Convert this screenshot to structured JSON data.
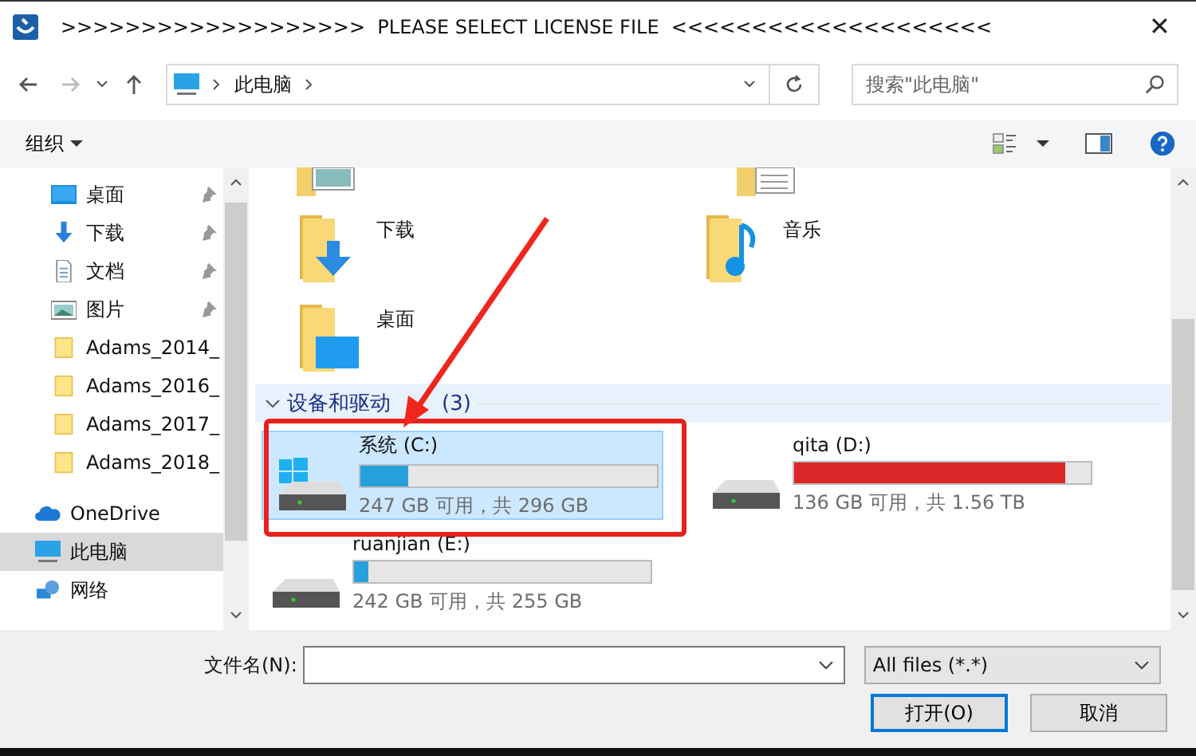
{
  "window": {
    "title": ">>>>>>>>>>>>>>>>>>>  PLEASE SELECT LICENSE FILE  <<<<<<<<<<<<<<<<<<<<",
    "close": "✕"
  },
  "nav": {
    "path": [
      "此电脑"
    ],
    "search": {
      "placeholder": "搜索\"此电脑\""
    }
  },
  "toolbar": {
    "organize": "组织"
  },
  "sidebar": {
    "items": [
      {
        "label": "桌面",
        "kind": "desktop",
        "pinned": true,
        "selected": false
      },
      {
        "label": "下载",
        "kind": "download",
        "pinned": true,
        "selected": false
      },
      {
        "label": "文档",
        "kind": "document",
        "pinned": true,
        "selected": false
      },
      {
        "label": "图片",
        "kind": "picture",
        "pinned": true,
        "selected": false
      },
      {
        "label": "Adams_2014_",
        "kind": "folder",
        "pinned": false,
        "selected": false
      },
      {
        "label": "Adams_2016_",
        "kind": "folder",
        "pinned": false,
        "selected": false
      },
      {
        "label": "Adams_2017_",
        "kind": "folder",
        "pinned": false,
        "selected": false
      },
      {
        "label": "Adams_2018_",
        "kind": "folder",
        "pinned": false,
        "selected": false
      },
      {
        "label": "OneDrive",
        "kind": "cloud",
        "pinned": false,
        "selected": false
      },
      {
        "label": "此电脑",
        "kind": "pc",
        "pinned": false,
        "selected": true
      },
      {
        "label": "网络",
        "kind": "network",
        "pinned": false,
        "selected": false
      }
    ]
  },
  "folders": [
    {
      "label": "下载",
      "kind": "download"
    },
    {
      "label": "音乐",
      "kind": "music"
    },
    {
      "label": "桌面",
      "kind": "desktop"
    }
  ],
  "section": {
    "title": "设备和驱动",
    "count": "(3)",
    "expanded": true
  },
  "drives": [
    {
      "name": "系统 (C:)",
      "detail": "247 GB 可用，共 296 GB",
      "level": 0.16,
      "color": "#26a0da",
      "kind": "system",
      "selected": true
    },
    {
      "name": "qita (D:)",
      "detail": "136 GB 可用，共 1.56 TB",
      "level": 0.915,
      "color": "#da2626",
      "kind": "disk",
      "selected": false
    },
    {
      "name": "ruanjian (E:)",
      "detail": "242 GB 可用，共 255 GB",
      "level": 0.05,
      "color": "#26a0da",
      "kind": "disk",
      "selected": false
    }
  ],
  "footer": {
    "filename_label": "文件名(N):",
    "filter": "All files (*.*)",
    "open": "打开(O)",
    "cancel": "取消"
  }
}
